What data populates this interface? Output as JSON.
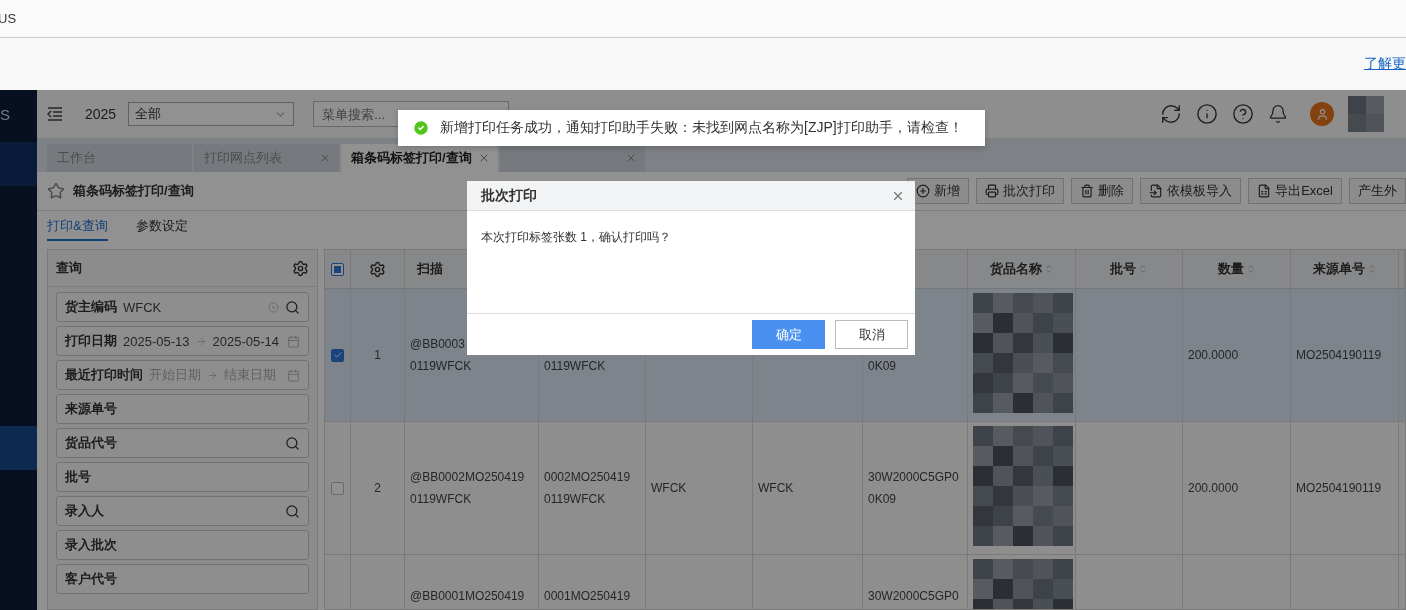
{
  "browser": {
    "title_fragment": "US",
    "link": "了解更"
  },
  "sidebar": {
    "logo_fragment": "S"
  },
  "header": {
    "year": "2025",
    "scope_select": "全部",
    "menu_search": {
      "placeholder": "菜单搜索..."
    }
  },
  "tabs": [
    {
      "label": "工作台",
      "closable": false,
      "selected": false
    },
    {
      "label": "打印网点列表",
      "closable": true,
      "selected": false
    },
    {
      "label": "箱条码标签打印/查询",
      "closable": true,
      "selected": true
    },
    {
      "closable": true,
      "selected": false
    }
  ],
  "page": {
    "title": "箱条码标签打印/查询",
    "starred": false
  },
  "toolbar": [
    {
      "kind": "add",
      "label": "新增"
    },
    {
      "kind": "print",
      "label": "批次打印"
    },
    {
      "kind": "delete",
      "label": "删除"
    },
    {
      "kind": "import",
      "label": "依模板导入"
    },
    {
      "kind": "export",
      "label": "导出Excel"
    },
    {
      "kind": "plain",
      "label": "产生外"
    }
  ],
  "sub_tabs": [
    {
      "label": "打印&查询",
      "selected": true
    },
    {
      "label": "参数设定",
      "selected": false
    }
  ],
  "query": {
    "title": "查询",
    "fields": [
      {
        "kind": "lookup",
        "label": "货主编码",
        "value": "WFCK"
      },
      {
        "kind": "date_range",
        "label": "打印日期",
        "start": "2025-05-13",
        "end": "2025-05-14"
      },
      {
        "kind": "date_range",
        "label": "最近打印时间",
        "start_placeholder": "开始日期",
        "end_placeholder": "结束日期"
      },
      {
        "kind": "text",
        "label": "来源单号"
      },
      {
        "kind": "lookup",
        "label": "货品代号"
      },
      {
        "kind": "text",
        "label": "批号"
      },
      {
        "kind": "lookup",
        "label": "录入人"
      },
      {
        "kind": "text",
        "label": "录入批次"
      },
      {
        "kind": "text",
        "label": "客户代号"
      }
    ]
  },
  "table": {
    "header_checkbox": {
      "checked": false,
      "indeterminate": true
    },
    "columns": [
      {
        "label": "扫描",
        "sortable": false
      },
      {},
      {},
      {},
      {},
      {
        "label": "货品名称",
        "sortable": true
      },
      {
        "label": "批号",
        "sortable": true
      },
      {
        "label": "数量",
        "sortable": true
      },
      {
        "label": "来源单号",
        "sortable": true
      }
    ],
    "rows": [
      {
        "index": "1",
        "checked": true,
        "selected": true,
        "cells": [
          {
            "kind": "text",
            "line_1": "@BB0003",
            "line_2": "0119WFCK"
          },
          {
            "kind": "text",
            "line_2": "0119WFCK"
          },
          null,
          null,
          {
            "kind": "text",
            "line_2": "0K09"
          },
          {
            "kind": "redacted"
          },
          null,
          {
            "kind": "text",
            "line_1": "200.0000"
          },
          {
            "kind": "text",
            "line_1": "MO2504190119"
          }
        ]
      },
      {
        "index": "2",
        "checked": false,
        "selected": false,
        "cells": [
          {
            "kind": "text",
            "line_1": "@BB0002MO250419",
            "line_2": "0119WFCK"
          },
          {
            "kind": "text",
            "line_1": "0002MO250419",
            "line_2": "0119WFCK"
          },
          {
            "kind": "text",
            "line_1": "WFCK"
          },
          {
            "kind": "text",
            "line_1": "WFCK"
          },
          {
            "kind": "text",
            "line_1": "30W2000C5GP0",
            "line_2": "0K09"
          },
          {
            "kind": "redacted"
          },
          null,
          {
            "kind": "text",
            "line_1": "200.0000"
          },
          {
            "kind": "text",
            "line_1": "MO2504190119"
          }
        ]
      },
      {
        "selected": false,
        "cells": [
          {
            "kind": "text",
            "line_1": "@BB0001MO250419"
          },
          {
            "kind": "text",
            "line_1": "0001MO250419"
          },
          null,
          null,
          {
            "kind": "text",
            "line_1": "30W2000C5GP0"
          },
          {
            "kind": "redacted"
          },
          null,
          null,
          null
        ]
      }
    ]
  },
  "toast": {
    "kind": "success",
    "message": "新增打印任务成功，通知打印助手失败：未找到网点名称为[ZJP]打印助手，请检查！"
  },
  "dialog": {
    "title": "批次打印",
    "message": "本次打印标签张数 1，确认打印吗？",
    "buttons": [
      {
        "kind": "primary",
        "label": "确定"
      },
      {
        "kind": "default",
        "label": "取消"
      }
    ]
  }
}
